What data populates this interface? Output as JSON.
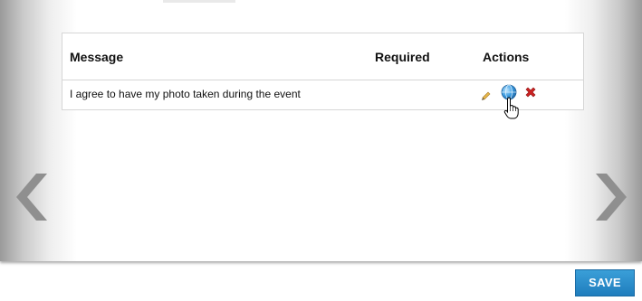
{
  "table": {
    "columns": [
      "Message",
      "Required",
      "Actions"
    ],
    "rows": [
      {
        "message": "I agree to have my photo taken during the event",
        "required": "",
        "actions": [
          "pencil-icon",
          "globe-icon",
          "delete-x-icon"
        ]
      }
    ]
  },
  "navigation": {
    "prev_icon": "chevron-left-icon",
    "next_icon": "chevron-right-icon"
  },
  "footer": {
    "save_label": "SAVE"
  },
  "colors": {
    "accent": "#1f7dbd",
    "delete": "#cc2222",
    "globe": "#2f8fd6"
  }
}
